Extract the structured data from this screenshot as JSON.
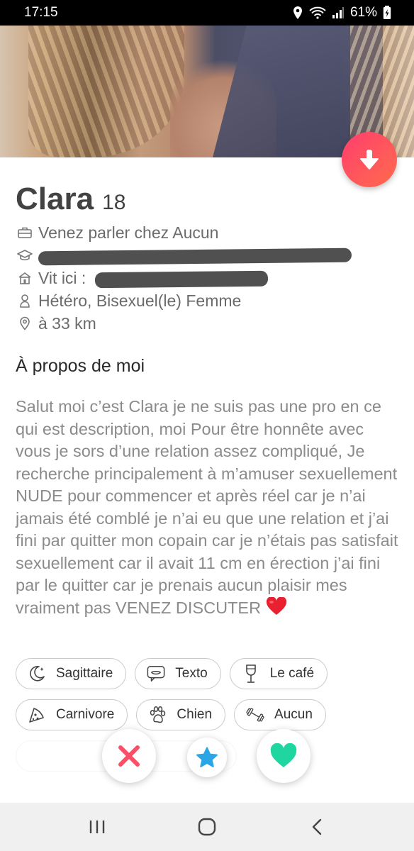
{
  "status_bar": {
    "time": "17:15",
    "battery_percent": "61%",
    "icons": [
      "location-icon",
      "wifi-icon",
      "signal-icon",
      "battery-icon"
    ]
  },
  "profile": {
    "name": "Clara",
    "age": "18",
    "job": "Venez parler chez Aucun",
    "school": "",
    "lives_in_prefix": "Vit ici : ",
    "orientation": "Hétéro, Bisexuel(le) Femme",
    "distance": "à 33 km"
  },
  "about": {
    "heading": "À propos de moi",
    "text": "Salut moi c’est Clara je ne suis pas une pro en ce qui est description, moi Pour être honnête avec vous je sors d’une relation assez compliqué, Je recherche principalement à m’amuser sexuellement NUDE pour commencer et après réel car je n’ai jamais été comblé je n’ai eu que une relation et j’ai fini par quitter mon copain car je n’étais pas satisfait sexuellement car il avait 11 cm en érection j’ai fini par le quitter car je prenais aucun plaisir mes vraiment pas VENEZ DISCUTER"
  },
  "chips": [
    {
      "label": "Sagittaire",
      "icon": "moon-icon"
    },
    {
      "label": "Texto",
      "icon": "chat-icon"
    },
    {
      "label": "Le café",
      "icon": "glass-icon"
    },
    {
      "label": "Carnivore",
      "icon": "pizza-icon"
    },
    {
      "label": "Chien",
      "icon": "paw-icon"
    },
    {
      "label": "Aucun",
      "icon": "dumbbell-icon"
    }
  ],
  "colors": {
    "accent": "#ff4f6a",
    "nope": "#fd4d67",
    "star": "#2aa5e6",
    "like": "#1fd6a0"
  }
}
